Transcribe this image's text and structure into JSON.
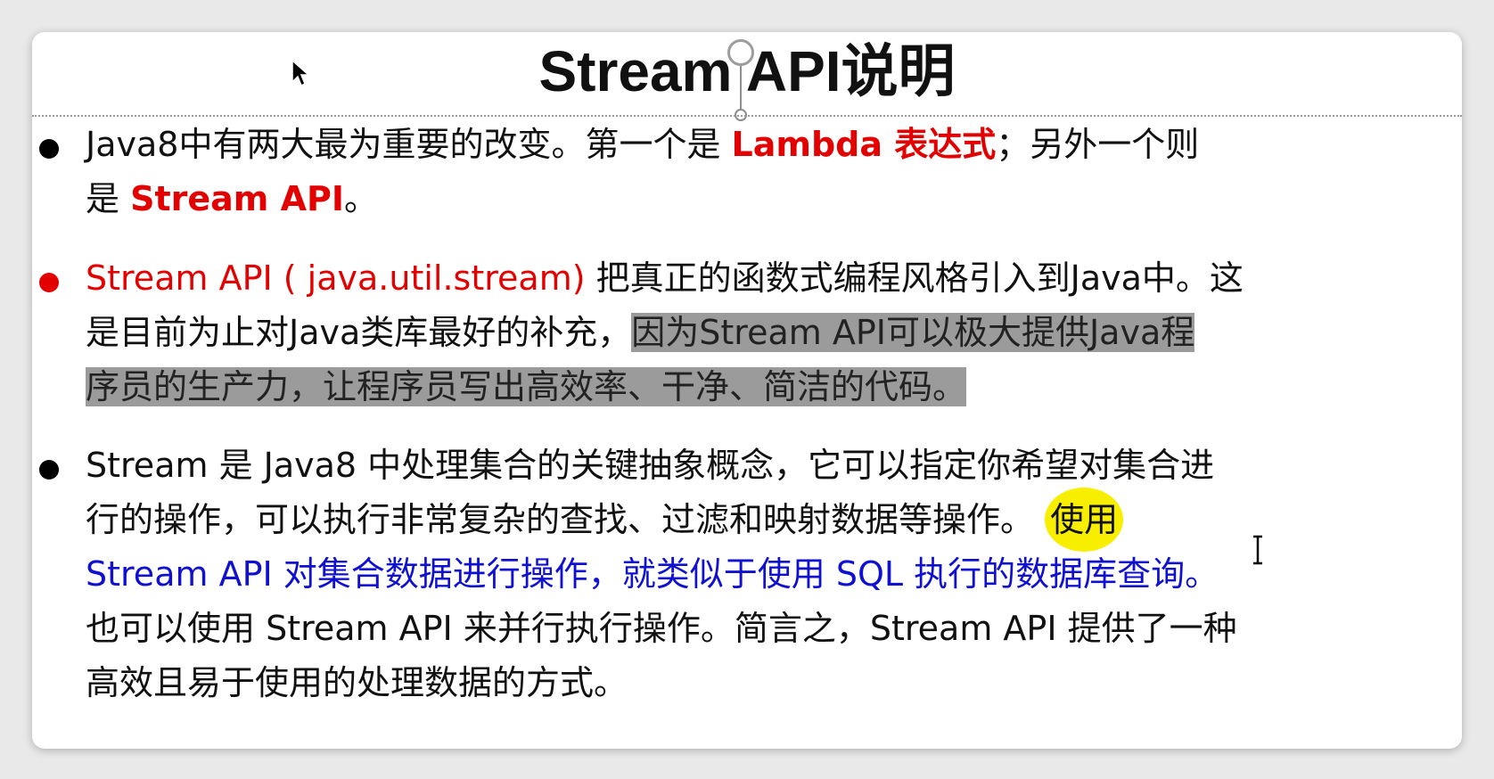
{
  "slide": {
    "title": "Stream API说明",
    "bullets": [
      {
        "line1_a": "Java8中有两大最为重要的改变。第一个是 ",
        "line1_b": "Lambda 表达式",
        "line1_c": "；另外一个则",
        "line2_a": "是 ",
        "line2_b": "Stream API",
        "line2_c": "。"
      },
      {
        "line1_a": "Stream API ( java.util.stream)",
        "line1_b": " 把真正的函数式编程风格引入到Java中。这",
        "line2_a": "是目前为止对Java类库最好的补充，",
        "line2_b": "因为Stream API可以极大提供Java程",
        "line3_a": "序员的生产力，让程序员写出高效率、干净、简洁的代码。"
      },
      {
        "line1_a": "Stream 是 Java8 中处理集合的关键抽象概念，它可以指定你希望对集合进",
        "line2_a": "行的操作，可以执行非常复杂的查找、过滤和映射数据等操作。 ",
        "line2_b": "使用",
        "line3_a": "Stream API 对集合数据进行操作，就类似于使用 SQL 执行的数据库查询。",
        "line4_a": "也可以使用 Stream API 来并行执行操作。简言之，Stream API 提供了一种",
        "line5_a": "高效且易于使用的处理数据的方式。"
      }
    ]
  },
  "colors": {
    "accent_red": "#e30000",
    "accent_blue": "#1010d0",
    "highlight_gray": "#9b9b9b",
    "highlight_yellow": "#f8ef00"
  },
  "icons": {
    "cursor": "arrow-cursor-icon",
    "ibeam": "text-ibeam-cursor-icon",
    "rotate": "rotate-handle-icon"
  }
}
